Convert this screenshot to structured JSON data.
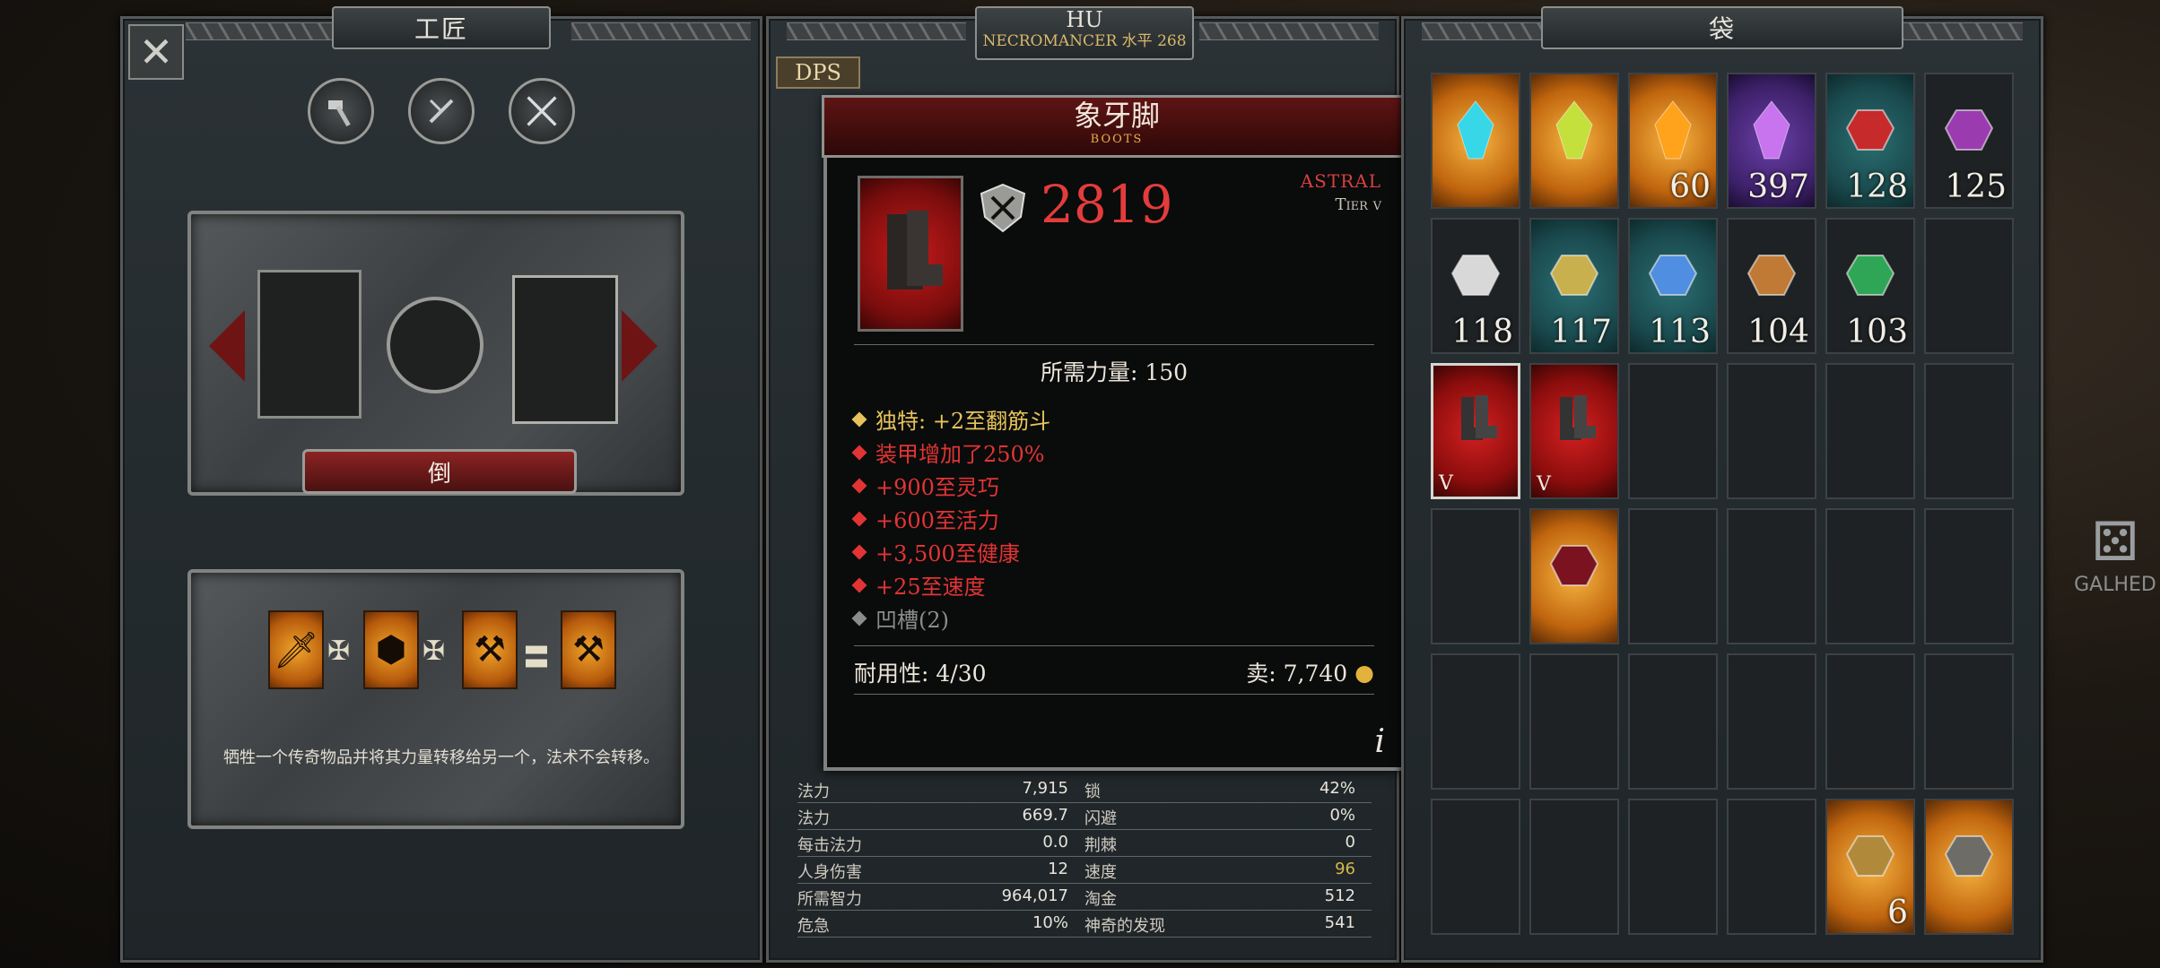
{
  "crafting": {
    "title": "工匠",
    "close_icon": "✕",
    "tool_icons": [
      "hammer-icon",
      "tongs-icon",
      "crossed-swords-icon"
    ],
    "craft_button": "倒",
    "recipe_operators": [
      "✠",
      "✠",
      "〓"
    ],
    "recipe_description": "牺牲一个传奇物品并将其力量转移给另一个，法术不会转移。"
  },
  "character": {
    "name": "HU",
    "subtitle": "NECROMANCER 水平 268",
    "dps_tab": "DPS",
    "stats": [
      {
        "l_label": "法力",
        "l_value": "7,915",
        "r_label": "锁",
        "r_value": "42%"
      },
      {
        "l_label": "法力",
        "l_value": "669.7",
        "r_label": "闪避",
        "r_value": "0%"
      },
      {
        "l_label": "每击法力",
        "l_value": "0.0",
        "r_label": "荆棘",
        "r_value": "0"
      },
      {
        "l_label": "人身伤害",
        "l_value": "12",
        "r_label": "速度",
        "r_value": "96"
      },
      {
        "l_label": "所需智力",
        "l_value": "964,017",
        "r_label": "淘金",
        "r_value": "512"
      },
      {
        "l_label": "危急",
        "l_value": "10%",
        "r_label": "神奇的发现",
        "r_value": "541"
      }
    ]
  },
  "tooltip": {
    "name": "象牙脚",
    "type": "BOOTS",
    "armor": "2819",
    "rarity": "ASTRAL",
    "tier": "Tier v",
    "requirement": "所需力量: 150",
    "properties": [
      {
        "text": "独特: +2至翻筋斗",
        "color": "#e6c35a"
      },
      {
        "text": "装甲增加了250%",
        "color": "#e23434"
      },
      {
        "text": "+900至灵巧",
        "color": "#e23434"
      },
      {
        "text": "+600至活力",
        "color": "#e23434"
      },
      {
        "text": "+3,500至健康",
        "color": "#e23434"
      },
      {
        "text": "+25至速度",
        "color": "#e23434"
      },
      {
        "text": "凹槽(2)",
        "color": "#8c8c8a"
      }
    ],
    "durability": "耐用性: 4/30",
    "sell": "卖: 7,740",
    "info": "i"
  },
  "bag": {
    "title": "袋",
    "items": [
      {
        "row": 0,
        "col": 0,
        "bg": "amber",
        "icon": "cyan-crystal-icon",
        "color": "#38d7e8",
        "count": ""
      },
      {
        "row": 0,
        "col": 1,
        "bg": "amber",
        "icon": "green-crystal-icon",
        "color": "#c4e03c",
        "count": ""
      },
      {
        "row": 0,
        "col": 2,
        "bg": "amber",
        "icon": "orange-crystal-icon",
        "color": "#ffa21c",
        "count": "60"
      },
      {
        "row": 0,
        "col": 3,
        "bg": "purple",
        "icon": "violet-crystal-icon",
        "color": "#c774ee",
        "count": "397"
      },
      {
        "row": 0,
        "col": 4,
        "bg": "teal",
        "icon": "ruby-gem-icon",
        "color": "#c62a2a",
        "count": "128"
      },
      {
        "row": 0,
        "col": 5,
        "bg": "none",
        "icon": "amethyst-gem-icon",
        "color": "#9a3bb0",
        "count": "125"
      },
      {
        "row": 1,
        "col": 0,
        "bg": "none",
        "icon": "diamond-gem-icon",
        "color": "#d8d8d8",
        "count": "118"
      },
      {
        "row": 1,
        "col": 1,
        "bg": "teal",
        "icon": "topaz-gem-icon",
        "color": "#c9b04e",
        "count": "117"
      },
      {
        "row": 1,
        "col": 2,
        "bg": "teal",
        "icon": "sapphire-gem-icon",
        "color": "#4f8ee0",
        "count": "113"
      },
      {
        "row": 1,
        "col": 3,
        "bg": "none",
        "icon": "amber-gem-icon",
        "color": "#c07a36",
        "count": "104"
      },
      {
        "row": 1,
        "col": 4,
        "bg": "none",
        "icon": "emerald-gem-icon",
        "color": "#2ea655",
        "count": "103"
      },
      {
        "row": 2,
        "col": 0,
        "bg": "red",
        "icon": "boots-icon",
        "color": "#2a2a2a",
        "tier": "V",
        "selected": true
      },
      {
        "row": 2,
        "col": 1,
        "bg": "red",
        "icon": "boots-icon",
        "color": "#2a2a2a",
        "tier": "V"
      },
      {
        "row": 3,
        "col": 1,
        "bg": "amber",
        "icon": "dark-ruby-icon",
        "color": "#7a1220",
        "count": ""
      },
      {
        "row": 5,
        "col": 4,
        "bg": "amber",
        "icon": "amber-stone-icon",
        "color": "#b08a3a",
        "count": "6"
      },
      {
        "row": 5,
        "col": 5,
        "bg": "amber",
        "icon": "relic-medallion-icon",
        "color": "#6e6c66",
        "count": ""
      }
    ]
  },
  "side": {
    "dice_label": "GALHED"
  }
}
